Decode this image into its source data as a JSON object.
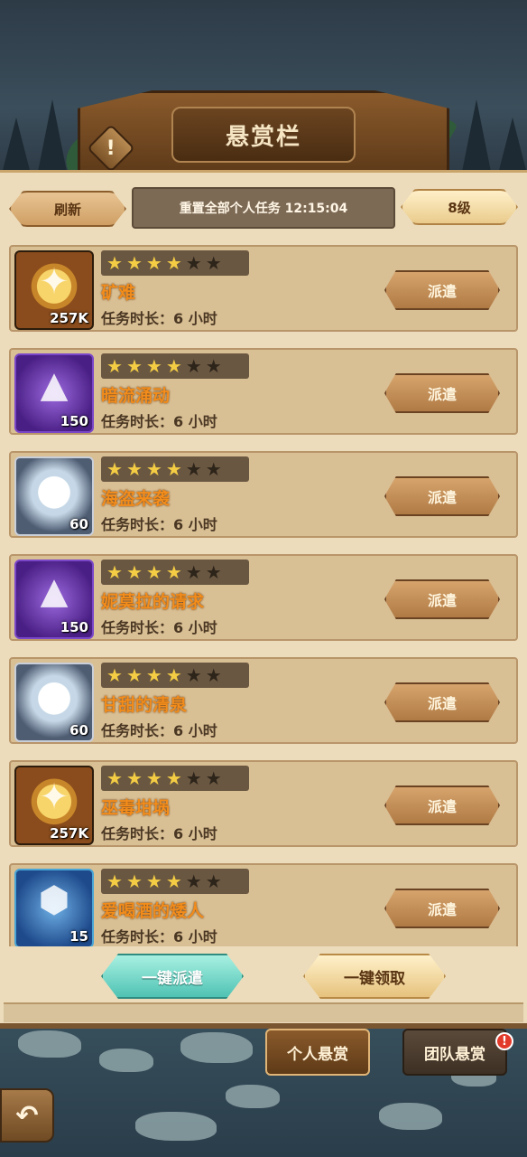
{
  "header": {
    "title": "悬赏栏",
    "alert_symbol": "!"
  },
  "toolbar": {
    "refresh_label": "刷新",
    "reset_text": "重置全部个人任务 12:15:04",
    "level_label": "8级"
  },
  "rows": [
    {
      "icon": "gold-compass-icon",
      "qty": "257K",
      "stars_on": 4,
      "stars_total": 6,
      "name": "矿难",
      "duration": "任务时长：6 小时",
      "action": "派遣"
    },
    {
      "icon": "purple-ore-icon",
      "qty": "150",
      "stars_on": 4,
      "stars_total": 6,
      "name": "暗流涌动",
      "duration": "任务时长：6 小时",
      "action": "派遣"
    },
    {
      "icon": "diamond-icon",
      "qty": "60",
      "stars_on": 4,
      "stars_total": 6,
      "name": "海盗来袭",
      "duration": "任务时长：6 小时",
      "action": "派遣"
    },
    {
      "icon": "purple-ore-icon",
      "qty": "150",
      "stars_on": 4,
      "stars_total": 6,
      "name": "妮莫拉的请求",
      "duration": "任务时长：6 小时",
      "action": "派遣"
    },
    {
      "icon": "diamond-icon",
      "qty": "60",
      "stars_on": 4,
      "stars_total": 6,
      "name": "甘甜的清泉",
      "duration": "任务时长：6 小时",
      "action": "派遣"
    },
    {
      "icon": "gold-compass-icon",
      "qty": "257K",
      "stars_on": 4,
      "stars_total": 6,
      "name": "巫毒坩埚",
      "duration": "任务时长：6 小时",
      "action": "派遣"
    },
    {
      "icon": "blue-shard-icon",
      "qty": "15",
      "stars_on": 4,
      "stars_total": 6,
      "name": "爱喝酒的矮人",
      "duration": "任务时长：6 小时",
      "action": "派遣"
    }
  ],
  "actions": {
    "dispatch_all": "一键派遣",
    "collect_all": "一键领取"
  },
  "tabs": {
    "personal": "个人悬赏",
    "team": "团队悬赏",
    "team_badge": "!"
  },
  "colors": {
    "panel": "#ecdcbb",
    "row": "#d9bf94",
    "name_orange": "#f28c1b",
    "star_gold": "#f4cd44",
    "teal_button": "#4fc3b4"
  }
}
